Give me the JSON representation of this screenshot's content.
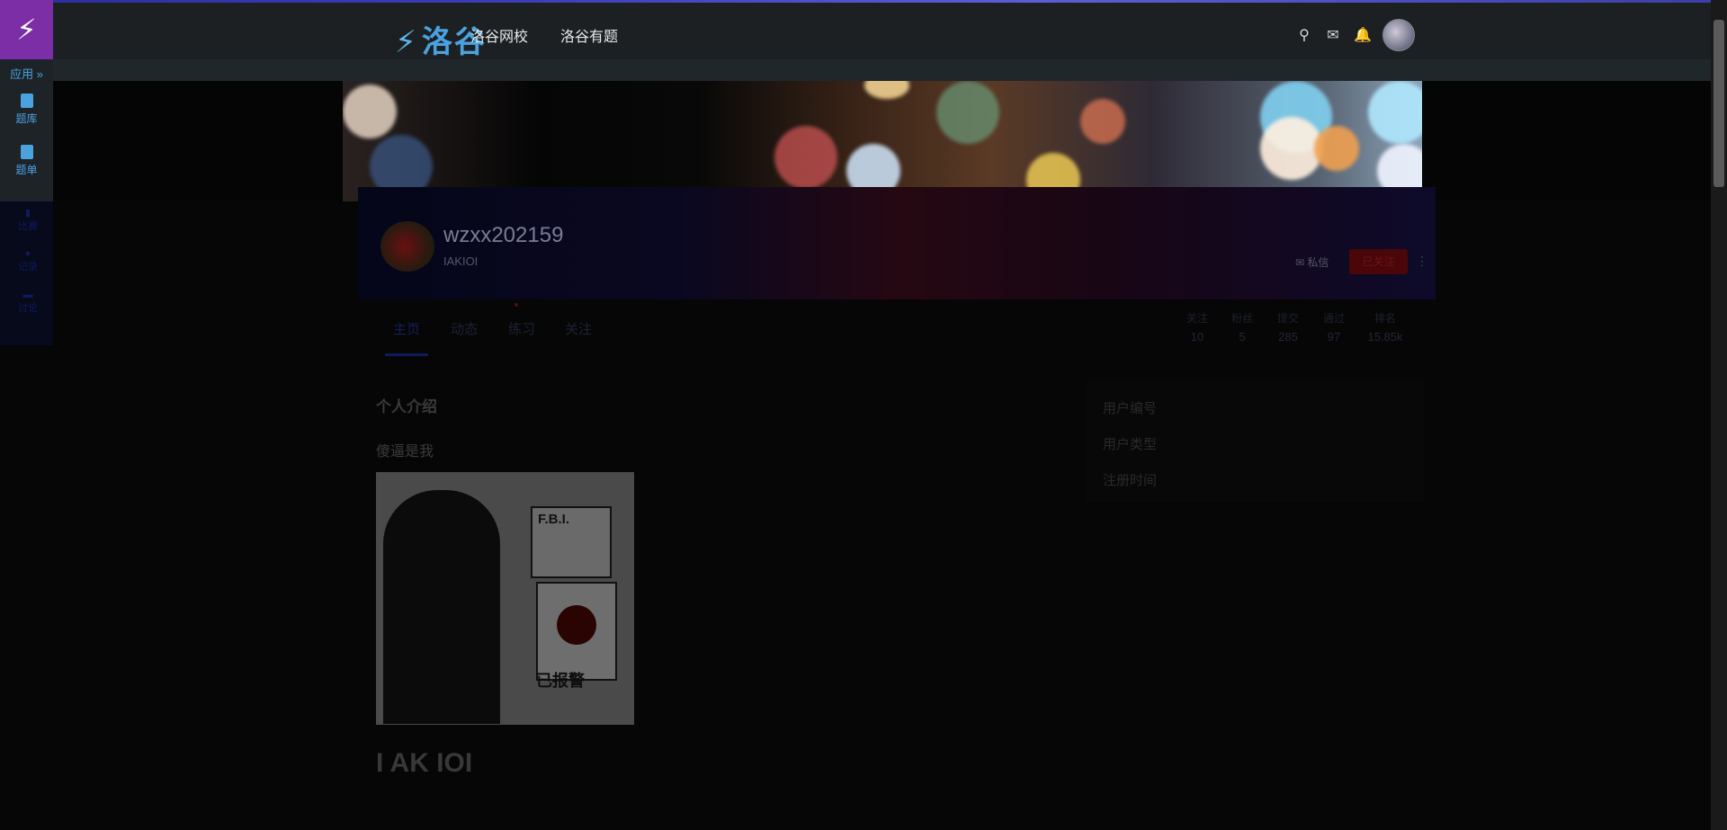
{
  "sidebar": {
    "logo_glyph": "⚡",
    "apps_label": "应用 »",
    "items": [
      {
        "label": "题库",
        "icon": "book-icon"
      },
      {
        "label": "题单",
        "icon": "clipboard-icon"
      },
      {
        "label": "比赛",
        "icon": "chart-icon"
      },
      {
        "label": "记录",
        "icon": "palette-icon"
      },
      {
        "label": "讨论",
        "icon": "comments-icon"
      }
    ]
  },
  "navbar": {
    "logo_text": "洛谷",
    "logo_glyph": "⚡",
    "links": [
      "洛谷网校",
      "洛谷有题"
    ],
    "icons": [
      "search-icon",
      "mail-icon",
      "bell-icon"
    ]
  },
  "profile": {
    "username": "wzxx202159",
    "tag": "IAKIOI",
    "message_label": "私信",
    "follow_label": "已关注",
    "more_glyph": "⋮"
  },
  "tabs": [
    "主页",
    "动态",
    "练习",
    "关注"
  ],
  "stats": [
    {
      "label": "关注",
      "value": "10"
    },
    {
      "label": "粉丝",
      "value": "5"
    },
    {
      "label": "提交",
      "value": "285"
    },
    {
      "label": "通过",
      "value": "97"
    },
    {
      "label": "排名",
      "value": "15.85k"
    }
  ],
  "intro": {
    "title": "个人介绍",
    "text": "傻逼是我",
    "image_fbi": "F.B.I.",
    "image_caption": "已报警",
    "big_text": "I AK IOI"
  },
  "info_card": {
    "rows": [
      {
        "label": "用户编号"
      },
      {
        "label": "用户类型"
      },
      {
        "label": "注册时间"
      }
    ]
  },
  "colors": {
    "sidebar_logo": "#7b2ea6",
    "accent": "#4aa3df",
    "navbar": "#1c2023"
  }
}
